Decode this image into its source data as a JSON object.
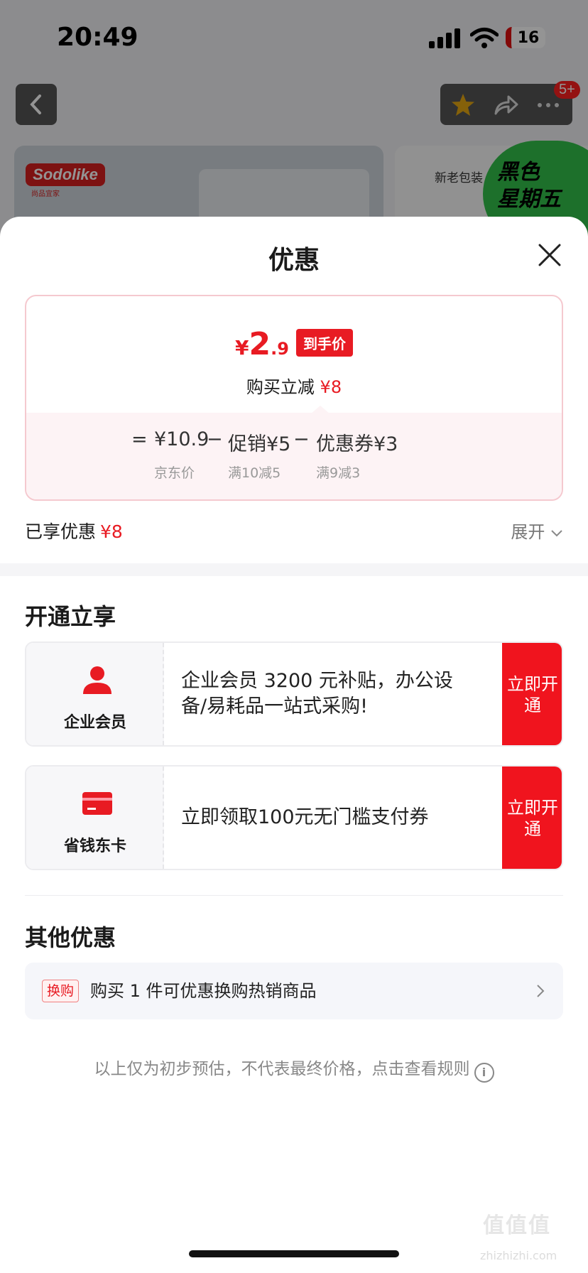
{
  "status_bar": {
    "time": "20:49",
    "battery": "16"
  },
  "background_page": {
    "badge": "5+",
    "brand_logo": "Sodolike",
    "brand_sub": "尚品宜家",
    "right_banner_text": "新老包装",
    "promo": [
      "黑色",
      "星期五"
    ]
  },
  "sheet": {
    "title": "优惠",
    "price": {
      "yen": "¥",
      "integer": "2",
      "decimal": ".9",
      "tag": "到手价",
      "instant_label": "购买立减",
      "instant_amount": "¥8"
    },
    "calc": {
      "eq": "=",
      "base": "¥10.9",
      "minus1": "−",
      "promo": "促销¥5",
      "minus2": "−",
      "coupon": "优惠券¥3",
      "base_sub": "京东价",
      "promo_sub": "满10减5",
      "coupon_sub": "满9减3"
    },
    "enjoyed": {
      "label": "已享优惠",
      "amount": "¥8",
      "expand": "展开"
    },
    "open_section": {
      "title": "开通立享",
      "cards": [
        {
          "name": "企业会员",
          "desc": "企业会员 3200 元补贴，办公设备/易耗品一站式采购!",
          "button": "立即开通",
          "icon": "person-icon",
          "color": "#e81b23"
        },
        {
          "name": "省钱东卡",
          "desc": "立即领取100元无门槛支付券",
          "button": "立即开通",
          "icon": "card-icon",
          "color": "#e81b23"
        }
      ]
    },
    "other_section": {
      "title": "其他优惠",
      "swap_tag": "换购",
      "swap_text": "购买 1 件可优惠换购热销商品"
    },
    "disclaimer": "以上仅为初步预估，不代表最终价格，点击查看规则"
  },
  "watermark": {
    "logo": "值值值",
    "url": "zhizhizhi.com"
  }
}
